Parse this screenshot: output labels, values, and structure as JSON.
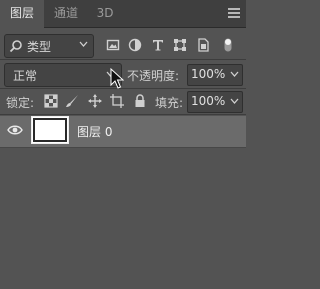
{
  "tabs": [
    {
      "label": "图层",
      "active": true
    },
    {
      "label": "通道",
      "active": false
    },
    {
      "label": "3D",
      "active": false
    }
  ],
  "filter": {
    "kind_label": "类型"
  },
  "blend": {
    "mode": "正常"
  },
  "opacity": {
    "label": "不透明度:",
    "value": "100%"
  },
  "lock": {
    "label": "锁定:"
  },
  "fill": {
    "label": "填充:",
    "value": "100%"
  },
  "layers": [
    {
      "name": "图层 0",
      "visible": true
    }
  ],
  "colors": {
    "panel": "#535353",
    "tabbar": "#3f3f3f",
    "selected_layer": "#6b6b6b"
  }
}
